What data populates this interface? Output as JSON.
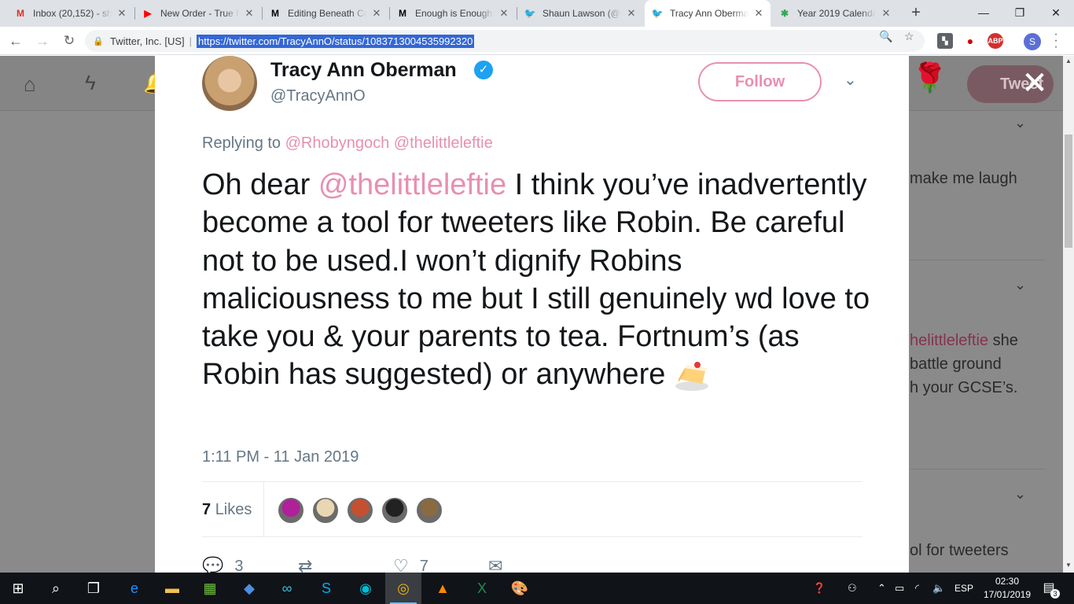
{
  "browser": {
    "tabs": [
      {
        "title": "Inbox (20,152) - sh",
        "icon": "gmail-icon",
        "icon_glyph": "M",
        "icon_color": "#d93025"
      },
      {
        "title": "New Order - True F",
        "icon": "youtube-icon",
        "icon_glyph": "▶",
        "icon_color": "#ff0000"
      },
      {
        "title": "Editing Beneath Co",
        "icon": "medium-icon",
        "icon_glyph": "M",
        "icon_color": "#000000"
      },
      {
        "title": "Enough is Enough.",
        "icon": "medium-icon",
        "icon_glyph": "M",
        "icon_color": "#000000"
      },
      {
        "title": "Shaun Lawson (@c",
        "icon": "twitter-icon",
        "icon_glyph": "🐦",
        "icon_color": "#1da1f2"
      },
      {
        "title": "Tracy Ann Oberma",
        "icon": "twitter-icon",
        "icon_glyph": "🐦",
        "icon_color": "#1da1f2",
        "active": true
      },
      {
        "title": "Year 2019 Calenda",
        "icon": "calendar-icon",
        "icon_glyph": "✱",
        "icon_color": "#34a853"
      }
    ],
    "site_identity": "Twitter, Inc. [US]",
    "url": "https://twitter.com/TracyAnnO/status/1083713004535992320",
    "profile_initial": "S",
    "ext_abp": "ABP"
  },
  "tweet": {
    "author_name": "Tracy Ann Oberman",
    "author_handle": "@TracyAnnO",
    "follow_label": "Follow",
    "replying_prefix": "Replying to",
    "replying_to": [
      "@Rhobyngoch",
      "@thelittleleftie"
    ],
    "text_before_mention": "Oh dear ",
    "mention": "@thelittleleftie",
    "text_after_mention": " I think you’ve inadvertently become a tool for tweeters like Robin. Be careful not to be used.I won’t dignify Robins maliciousness to me  but I still genuinely wd love to take you & your parents to tea. Fortnum’s (as Robin has suggested) or anywhere ",
    "emoji": "cake-icon",
    "timestamp": "1:11 PM - 11 Jan 2019",
    "likes_count": "7",
    "likes_label": "Likes",
    "reply_count": "3",
    "retweet_count": "",
    "like_count": "7",
    "liker_avatar_colors": [
      "#b0209a",
      "#e8d7b0",
      "#c45030",
      "#222222",
      "#8a6a40"
    ]
  },
  "background": {
    "tweet_button": "Tweet",
    "side_snippets": {
      "s1": "make me laugh",
      "s2_link": "helittleleftie",
      "s2_rest": " she",
      "s3": " battle ground",
      "s4": "h your GCSE’s.",
      "s5": "ol for tweeters"
    }
  },
  "taskbar": {
    "lang": "ESP",
    "time": "02:30",
    "date": "17/01/2019",
    "notifications": "3"
  }
}
